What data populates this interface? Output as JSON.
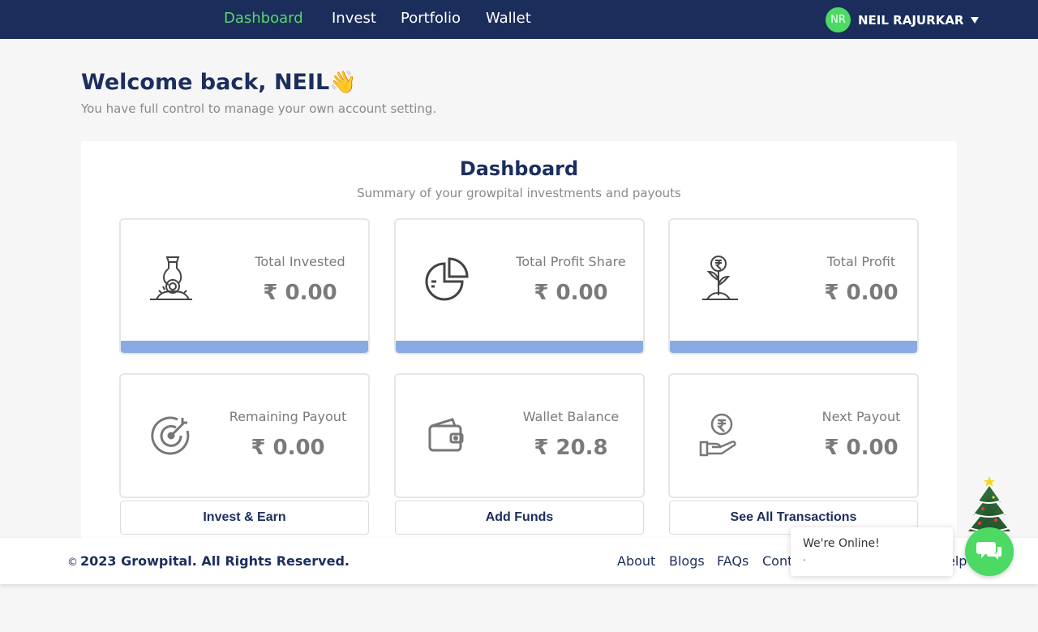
{
  "nav": {
    "links": [
      "Dashboard",
      "Invest",
      "Portfolio",
      "Wallet"
    ],
    "active_color": "#5ad86a",
    "bg_color": "#1b2d5b"
  },
  "user": {
    "initials": "NR",
    "name": "NEIL RAJURKAR"
  },
  "welcome": {
    "title": "Welcome back, NEIL👋",
    "subtitle": "You have full control to manage your own account setting."
  },
  "dashboard": {
    "title": "Dashboard",
    "subtitle": "Summary of your growpital investments and payouts",
    "cards": [
      {
        "label": "Total Invested",
        "value": "₹ 0.00",
        "icon": "invest-plant-coin-icon"
      },
      {
        "label": "Total Profit Share",
        "value": "₹ 0.00",
        "icon": "pie-chart-icon"
      },
      {
        "label": "Total Profit",
        "value": "₹ 0.00",
        "icon": "rupee-plant-icon"
      },
      {
        "label": "Remaining Payout",
        "value": "₹ 0.00",
        "icon": "target-icon"
      },
      {
        "label": "Wallet Balance",
        "value": "₹ 20.8",
        "icon": "wallet-icon"
      },
      {
        "label": "Next Payout",
        "value": "₹ 0.00",
        "icon": "hand-rupee-icon"
      }
    ],
    "actions": [
      "Invest & Earn",
      "Add Funds",
      "See All Transactions"
    ]
  },
  "footer": {
    "copyright_symbol": "©",
    "copyright": "2023 Growpital. All Rights Reserved.",
    "links": [
      "About",
      "Blogs",
      "FAQs",
      "Cont",
      "elp"
    ]
  },
  "chat": {
    "status": "We're Online!",
    "message": "."
  },
  "colors": {
    "brand": "#1c2e5e",
    "accent_bar": "#8aaae3",
    "online_green": "#4cd964"
  }
}
